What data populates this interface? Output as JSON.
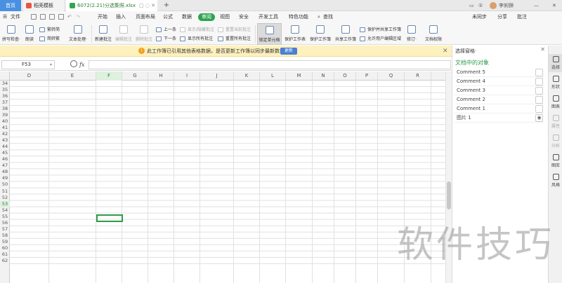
{
  "tabbar": {
    "home_label": "首页",
    "template_label": "稻壳模板",
    "file_label": "6072(2.21)分选集照.xlsx",
    "file_ctl": "▢ ◌ ✕",
    "add_label": "+",
    "right": {
      "monitor": "▭",
      "badge": "①",
      "user": "李刹翀",
      "min": "—",
      "close": "✕"
    }
  },
  "menubar": {
    "file_label": "文件",
    "items": [
      "开始",
      "插入",
      "页面布局",
      "公式",
      "数据",
      "审阅",
      "视图",
      "安全",
      "开发工具",
      "特色功能"
    ],
    "active_item": "审阅",
    "search_label": "查找",
    "right": {
      "sync": "未同步",
      "share": "分享",
      "comment": "批注"
    }
  },
  "ribbon": {
    "spell_check": "拼写检查·",
    "read_aloud": "朗读",
    "trad_to_simp": "繁转简",
    "simp_to_trad": "简转繁",
    "text_process": "文本处理·",
    "new_comment": "新建批注",
    "edit_comment": "编辑批注",
    "delete_comment": "删除批注",
    "prev": "上一条",
    "next": "下一条",
    "show_hide_comment": "显示/隐藏批注",
    "show_all_comments": "显示所有批注",
    "reset_current_comment": "重置当前批注",
    "reset_all_comments": "重置所有批注",
    "lock_cell": "锁定单元格",
    "protect_sheet": "保护工作表",
    "protect_book": "保护工作簿",
    "share_book": "共享工作簿",
    "protect_and_share": "保护并共享工作簿",
    "allow_edit_range": "允许用户编辑区域",
    "revise": "修订·",
    "doc_rights": "文档权限"
  },
  "notification": {
    "text": "此工作簿已引用其他表格数据，是否更新工作簿以同步最新数据？",
    "button": "更新",
    "close": "✕"
  },
  "formula_bar": {
    "name_box": "F53",
    "fx": "fx"
  },
  "grid": {
    "columns": [
      "D",
      "E",
      "F",
      "G",
      "H",
      "I",
      "J",
      "K",
      "L",
      "M",
      "N",
      "O",
      "P",
      "Q",
      "R"
    ],
    "selected_column": "F",
    "rows": [
      "34",
      "35",
      "36",
      "37",
      "38",
      "39",
      "40",
      "41",
      "42",
      "43",
      "44",
      "45",
      "46",
      "47",
      "48",
      "49",
      "50",
      "51",
      "52",
      "53",
      "54",
      "55",
      "56",
      "57",
      "58",
      "59",
      "60",
      "61",
      "62"
    ],
    "selected_row": "53"
  },
  "selection_pane": {
    "title": "选择窗格·",
    "subtitle": "文档中的对象",
    "close": "✕",
    "items": [
      "Comment 5",
      "Comment 4",
      "Comment 3",
      "Comment 2",
      "Comment 1",
      "图片 1"
    ]
  },
  "rail": {
    "items": [
      "选择",
      "形状",
      "图表",
      "属性",
      "分析",
      "图库",
      "风格"
    ]
  },
  "watermark": "软件技巧"
}
